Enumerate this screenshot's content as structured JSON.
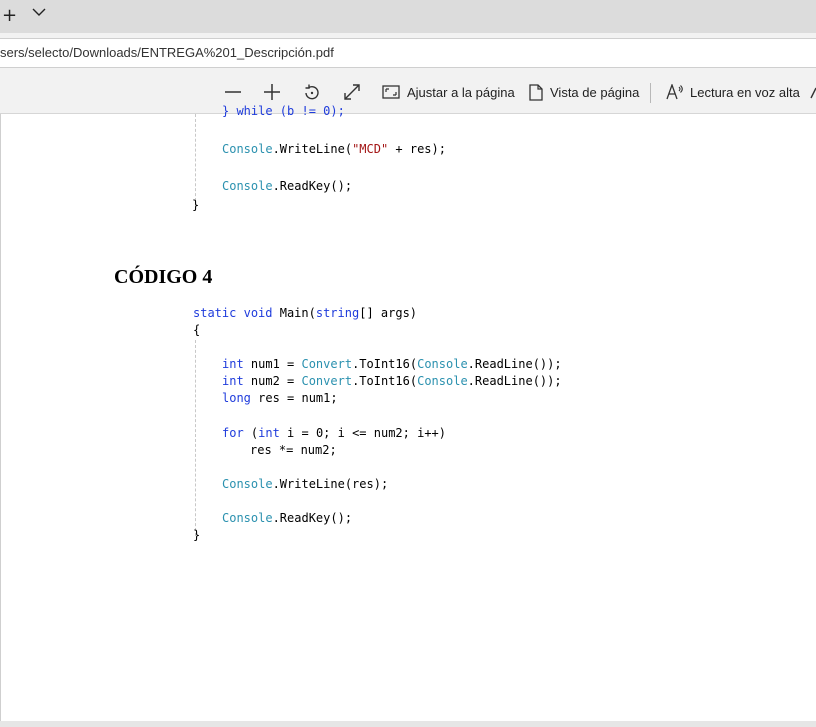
{
  "browser": {
    "tab_actions": {
      "new_tab": "+",
      "tab_list": "⌄"
    },
    "address": "sers/selecto/Downloads/ENTREGA%201_Descripción.pdf"
  },
  "toolbar": {
    "zoom_out_icon": "minus-icon",
    "zoom_in_icon": "plus-icon",
    "rotate_icon": "rotate-icon",
    "fullscreen_icon": "expand-icon",
    "fit_label": "Ajustar a la página",
    "page_view_label": "Vista de página",
    "read_aloud_label": "Lectura en voz alta"
  },
  "document": {
    "prev_code": {
      "line0": "} while (b != 0);",
      "line1_obj": "Console",
      "line1_call": ".WriteLine(",
      "line1_str": "\"MCD\"",
      "line1_rest": " + res);",
      "line2_obj": "Console",
      "line2_rest": ".ReadKey();",
      "close": "}"
    },
    "heading": "CÓDIGO 4",
    "code4": {
      "kw_static": "static",
      "kw_void": "void",
      "main_open": " Main(",
      "kw_string": "string",
      "main_rest": "[] args)",
      "open_brace": "{",
      "kw_int": "int",
      "num1_mid": " num1 = ",
      "convert": "Convert",
      "toint": ".ToInt16(",
      "console": "Console",
      "readline": ".ReadLine());",
      "num2_mid": " num2 = ",
      "kw_long": "long",
      "res_rest": " res = num1;",
      "kw_for": "for",
      "for_open": " (",
      "for_rest": " i = 0; i <= num2; i++)",
      "body": "res *= num2;",
      "writeline": ".WriteLine(res);",
      "readkey": ".ReadKey();",
      "close_brace": "}"
    }
  }
}
